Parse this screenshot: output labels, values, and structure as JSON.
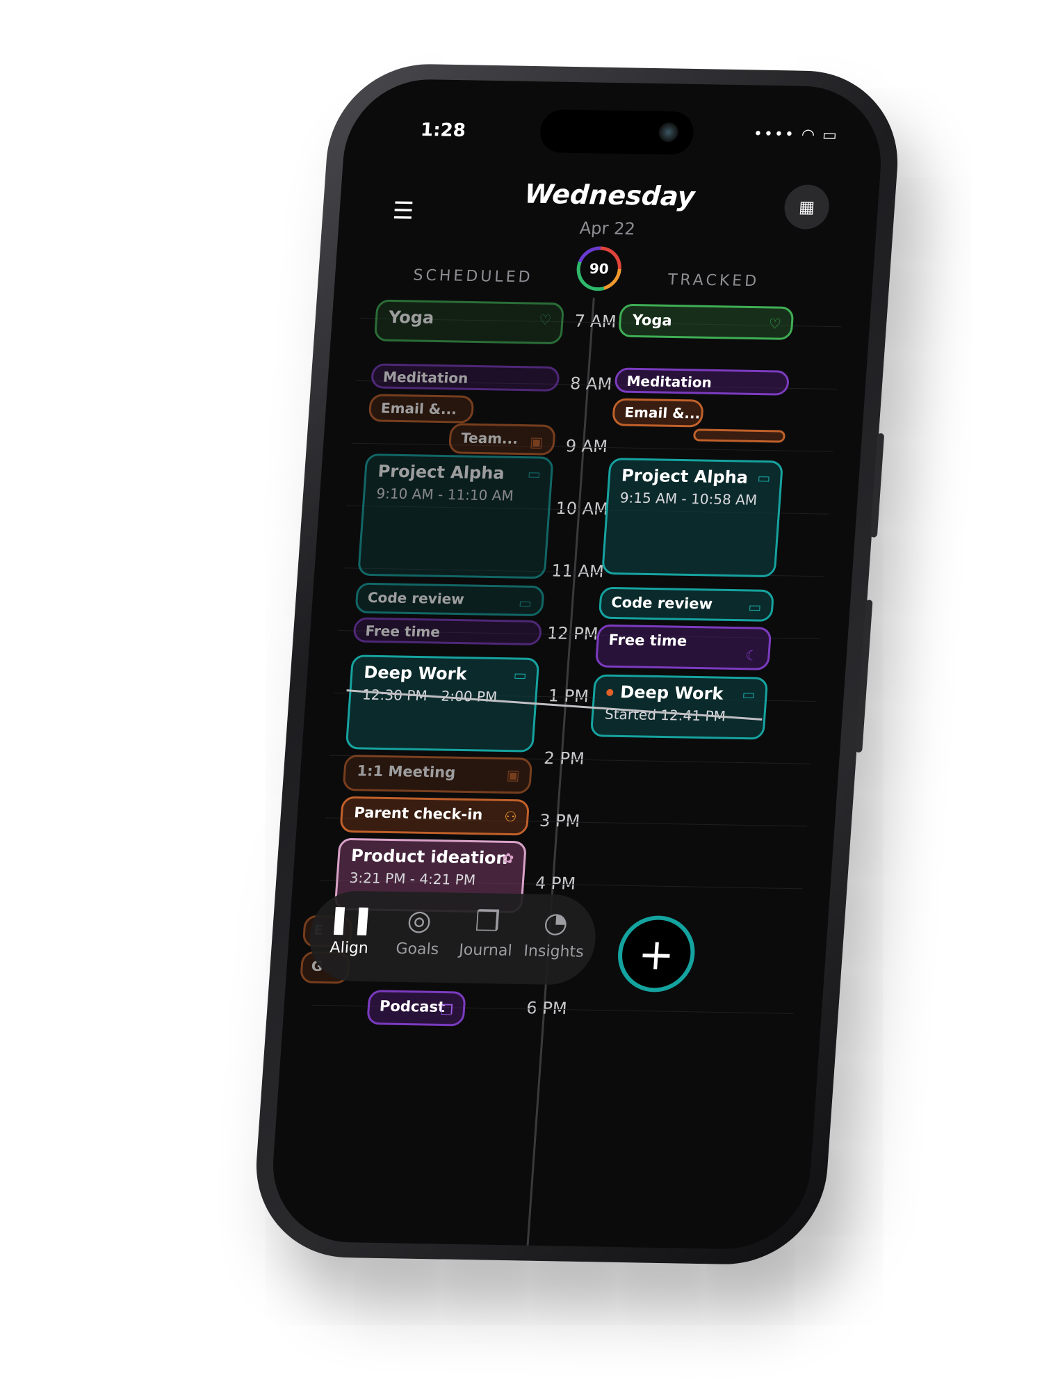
{
  "status": {
    "time": "1:28"
  },
  "header": {
    "day": "Wednesday",
    "date": "Apr 22"
  },
  "columns": {
    "scheduled": "SCHEDULED",
    "tracked": "TRACKED",
    "score": "90"
  },
  "hours": [
    "7 AM",
    "8 AM",
    "9 AM",
    "10 AM",
    "11 AM",
    "12 PM",
    "1 PM",
    "2 PM",
    "3 PM",
    "4 PM",
    "6 PM"
  ],
  "scheduled_events": {
    "yoga": "Yoga",
    "meditation": "Meditation",
    "email": "Email &...",
    "team": "Team...",
    "alpha_title": "Project Alpha",
    "alpha_time": "9:10 AM - 11:10 AM",
    "code_review": "Code review",
    "free_time": "Free time",
    "deep_title": "Deep Work",
    "deep_time": "12:30 PM - 2:00 PM",
    "meeting": "1:1 Meeting",
    "parent": "Parent check-in",
    "ideation_title": "Product ideation",
    "ideation_time": "3:21 PM - 4:21 PM",
    "e_partial": "E",
    "g_partial": "G",
    "podcast": "Podcast"
  },
  "tracked_events": {
    "yoga": "Yoga",
    "meditation": "Meditation",
    "email": "Email &...",
    "alpha_title": "Project Alpha",
    "alpha_time": "9:15 AM - 10:58 AM",
    "code_review": "Code review",
    "free_time": "Free time",
    "deep_title": "Deep Work",
    "deep_time": "Started 12:41 PM"
  },
  "tabs": [
    {
      "label": "Align",
      "icon": "align-icon"
    },
    {
      "label": "Goals",
      "icon": "target-icon"
    },
    {
      "label": "Journal",
      "icon": "bookmark-icon"
    },
    {
      "label": "Insights",
      "icon": "donut-chart-icon"
    }
  ],
  "colors": {
    "teal": "#16a3a0",
    "green": "#3fae55",
    "purple": "#7b3bbf",
    "orange": "#c0602a",
    "pink": "#d9a2c8"
  }
}
